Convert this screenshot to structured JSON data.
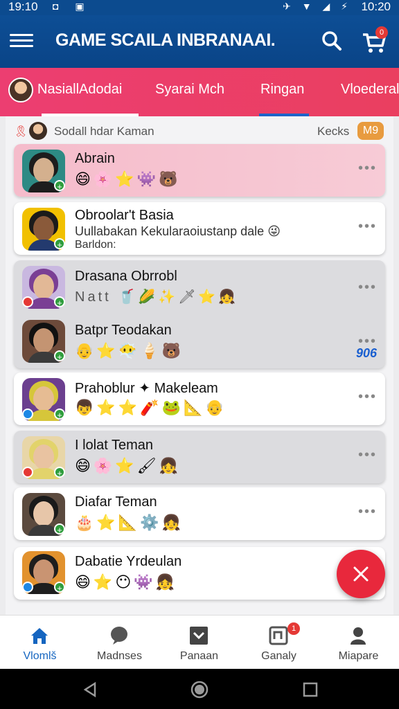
{
  "status_bar": {
    "time_left": "19:10",
    "time_right": "10:20"
  },
  "app_bar": {
    "title": "GAME SCAILA INBRANAAI.",
    "cart_badge": "0"
  },
  "tabs": [
    {
      "label": "NasiallAdodai",
      "active": true
    },
    {
      "label": "Syarai Mch",
      "active": false
    },
    {
      "label": "Ringan",
      "active": false
    },
    {
      "label": "Vloederal",
      "active": false
    }
  ],
  "subheader": {
    "text": "Sodall hdar Kaman",
    "right_label": "Kecks",
    "badge": "M9"
  },
  "cards": [
    {
      "name": "Abrain",
      "emoji": "😄🌸⭐👾🐻",
      "more": "•••"
    },
    {
      "name": "Obroolar't Basia",
      "line1": "Uullabakan Kekularaoiustanp dale 😜",
      "line2": "Barldon:",
      "more": "•••"
    },
    {
      "name": "Drasana Obrrobl",
      "emoji": "Natt 🥤🌽✨🗡⭐👧",
      "more": "•••"
    },
    {
      "name": "Batpr Teodakan",
      "emoji": "👴⭐😶‍🌫️🍦🐻",
      "more": "•••",
      "count": "906"
    },
    {
      "name": "Prahoblur ✦ Makeleam",
      "emoji": "👦⭐⭐🧨🐸📐👴",
      "more": "•••"
    },
    {
      "name": "I lolat Teman",
      "emoji": "😄🌸⭐🖌👧",
      "more": "•••"
    },
    {
      "name": "Diafar Teman",
      "emoji": "🎂⭐📐⚙️👧",
      "more": "•••"
    },
    {
      "name": "Dabatie Yrdeulan",
      "emoji": "😄⭐😶👾👧"
    }
  ],
  "bottom_nav": [
    {
      "label": "Vlomlš",
      "active": true
    },
    {
      "label": "Madnses",
      "active": false
    },
    {
      "label": "Panaan",
      "active": false
    },
    {
      "label": "Ganaly",
      "active": false,
      "badge": "1"
    },
    {
      "label": "Miapare",
      "active": false
    }
  ],
  "colors": {
    "app_bar": "#0c4b8f",
    "tab_bar": "#ea3f66",
    "fab": "#e8283c",
    "active_nav": "#1565c0"
  }
}
